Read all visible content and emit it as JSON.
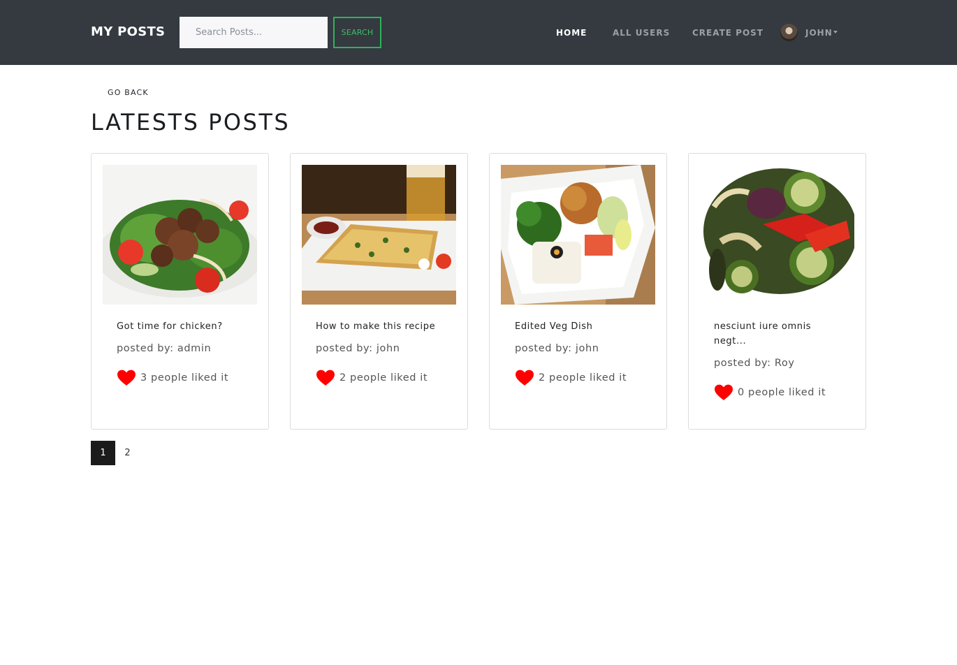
{
  "navbar": {
    "brand": "MY POSTS",
    "search_placeholder": "Search Posts...",
    "search_button": "SEARCH",
    "links": [
      "HOME",
      "ALL USERS",
      "CREATE POST"
    ],
    "user_name": "JOHN"
  },
  "go_back": "GO BACK",
  "page_title": "LATESTS POSTS",
  "posts": [
    {
      "title": "Got time for chicken?",
      "posted_by": "posted by: admin",
      "likes": "3 people liked it"
    },
    {
      "title": "How to make this recipe",
      "posted_by": "posted by: john",
      "likes": "2 people liked it"
    },
    {
      "title": "Edited Veg Dish",
      "posted_by": "posted by: john",
      "likes": "2 people liked it"
    },
    {
      "title": "nesciunt iure omnis negt...",
      "posted_by": "posted by: Roy",
      "likes": "0 people liked it"
    }
  ],
  "pagination": [
    "1",
    "2"
  ],
  "colors": {
    "navbar": "#343a40",
    "search_border": "#2fb35a",
    "heart": "#ff0000",
    "active_page": "#1b1b1b"
  }
}
